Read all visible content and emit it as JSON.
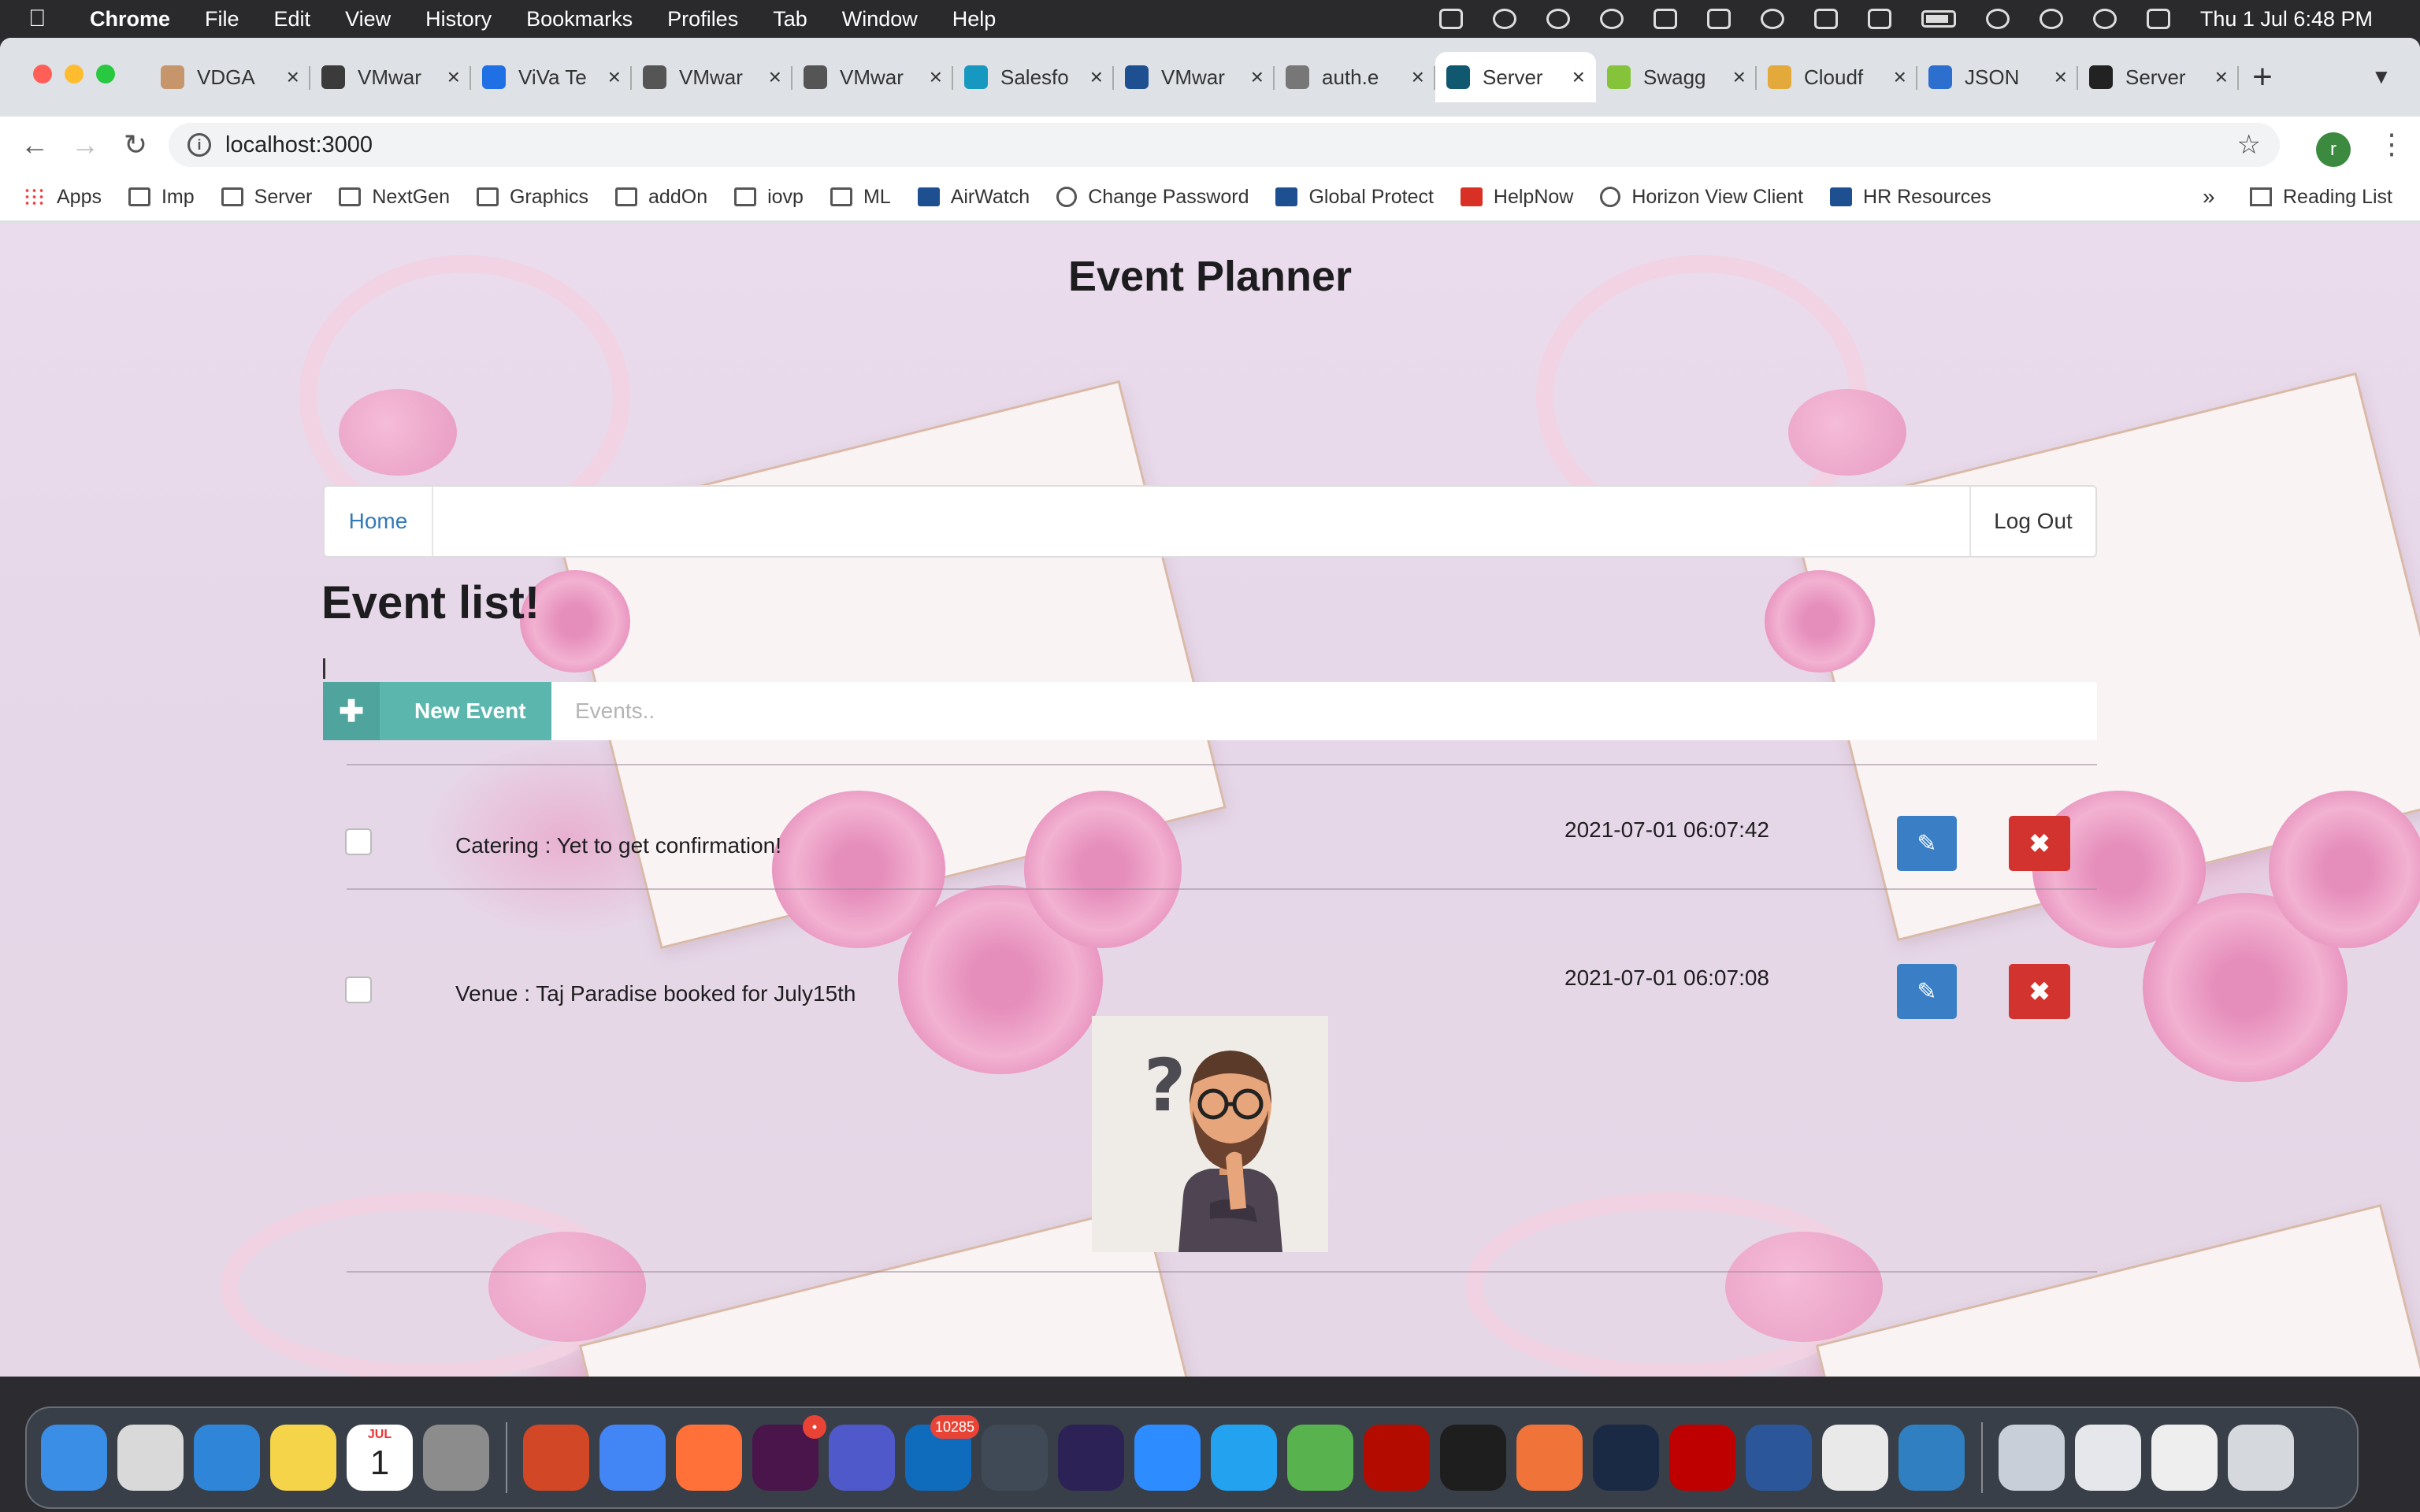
{
  "menubar": {
    "app": "Chrome",
    "items": [
      "File",
      "Edit",
      "View",
      "History",
      "Bookmarks",
      "Profiles",
      "Tab",
      "Window",
      "Help"
    ],
    "clock": "Thu 1 Jul  6:48 PM"
  },
  "browser": {
    "tabs": [
      {
        "title": "VDGA",
        "color": "#c7956c"
      },
      {
        "title": "VMwar",
        "color": "#3b3b3b"
      },
      {
        "title": "ViVa Te",
        "color": "#1f6fe5"
      },
      {
        "title": "VMwar",
        "color": "#555555"
      },
      {
        "title": "VMwar",
        "color": "#555555"
      },
      {
        "title": "Salesfo",
        "color": "#1798c1"
      },
      {
        "title": "VMwar",
        "color": "#1d4f91"
      },
      {
        "title": "auth.e",
        "color": "#777777"
      },
      {
        "title": "Server",
        "color": "#0f5870"
      },
      {
        "title": "Swagg",
        "color": "#85c43a"
      },
      {
        "title": "Cloudf",
        "color": "#e3a93b"
      },
      {
        "title": "JSON",
        "color": "#2c6fcf"
      },
      {
        "title": "Server",
        "color": "#222222"
      }
    ],
    "active_tab_index": 8,
    "url": "localhost:3000",
    "profile_initial": "r",
    "bookmarks": [
      {
        "label": "Apps",
        "icon": "apps"
      },
      {
        "label": "Imp",
        "icon": "folder"
      },
      {
        "label": "Server",
        "icon": "folder"
      },
      {
        "label": "NextGen",
        "icon": "folder"
      },
      {
        "label": "Graphics",
        "icon": "folder"
      },
      {
        "label": "addOn",
        "icon": "folder"
      },
      {
        "label": "iovp",
        "icon": "folder"
      },
      {
        "label": "ML",
        "icon": "folder"
      },
      {
        "label": "AirWatch",
        "icon": "vm"
      },
      {
        "label": "Change Password",
        "icon": "globe"
      },
      {
        "label": "Global Protect",
        "icon": "vm"
      },
      {
        "label": "HelpNow",
        "icon": "now"
      },
      {
        "label": "Horizon View Client",
        "icon": "globe"
      },
      {
        "label": "HR Resources",
        "icon": "vm"
      }
    ],
    "bookmarks_more": "»",
    "reading_list": "Reading List"
  },
  "page": {
    "title": "Event Planner",
    "nav": {
      "home": "Home",
      "logout": "Log Out"
    },
    "list_title": "Event list!",
    "new_event_label": "New Event",
    "search_placeholder": "Events..",
    "events": [
      {
        "text": "Catering : Yet to get confirmation!",
        "timestamp": "2021-07-01 06:07:42",
        "checked": false
      },
      {
        "text": "Venue : Taj Paradise booked for July15th",
        "timestamp": "2021-07-01 06:07:08",
        "checked": false
      }
    ],
    "colors": {
      "teal": "#5bb7ae",
      "edit_blue": "#3a7fc6",
      "delete_red": "#d2332f",
      "link": "#337ab7"
    }
  },
  "dock": {
    "apps": [
      {
        "name": "finder",
        "color": "#3a8ee6"
      },
      {
        "name": "launchpad",
        "color": "#d9d9d9"
      },
      {
        "name": "safari",
        "color": "#2f86d8"
      },
      {
        "name": "notes",
        "color": "#f6d44a"
      },
      {
        "name": "calendar",
        "color": "#ffffff"
      },
      {
        "name": "system-preferences",
        "color": "#8c8c8c"
      },
      {
        "name": "powerpoint",
        "color": "#d24726"
      },
      {
        "name": "chrome",
        "color": "#4285f4"
      },
      {
        "name": "firefox",
        "color": "#ff7139"
      },
      {
        "name": "slack",
        "color": "#4a154b"
      },
      {
        "name": "teams",
        "color": "#5059c9"
      },
      {
        "name": "outlook",
        "color": "#0f6cbd"
      },
      {
        "name": "screen-sharing",
        "color": "#404a56"
      },
      {
        "name": "eclipse",
        "color": "#2c2255"
      },
      {
        "name": "zoom",
        "color": "#2d8cff"
      },
      {
        "name": "vscode",
        "color": "#23a2f0"
      },
      {
        "name": "cloud-app",
        "color": "#58b24e"
      },
      {
        "name": "acrobat",
        "color": "#b30b00"
      },
      {
        "name": "terminal",
        "color": "#1e1e1e"
      },
      {
        "name": "paintbrush",
        "color": "#f0733a"
      },
      {
        "name": "vpn-client",
        "color": "#1b2a44"
      },
      {
        "name": "filezilla",
        "color": "#bf0000"
      },
      {
        "name": "word",
        "color": "#2b579a"
      },
      {
        "name": "textedit",
        "color": "#e9e9e9"
      },
      {
        "name": "remote-desktop",
        "color": "#2f7fc1"
      },
      {
        "name": "downloads-stack",
        "color": "#c9cfd8"
      },
      {
        "name": "documents-stack",
        "color": "#e5e7ea"
      },
      {
        "name": "files-stack",
        "color": "#eeeeee"
      },
      {
        "name": "trash",
        "color": "#d5d8dc"
      }
    ],
    "calendar_month": "JUL",
    "calendar_day": "1",
    "outlook_badge": "10285",
    "slack_badge": "•"
  }
}
